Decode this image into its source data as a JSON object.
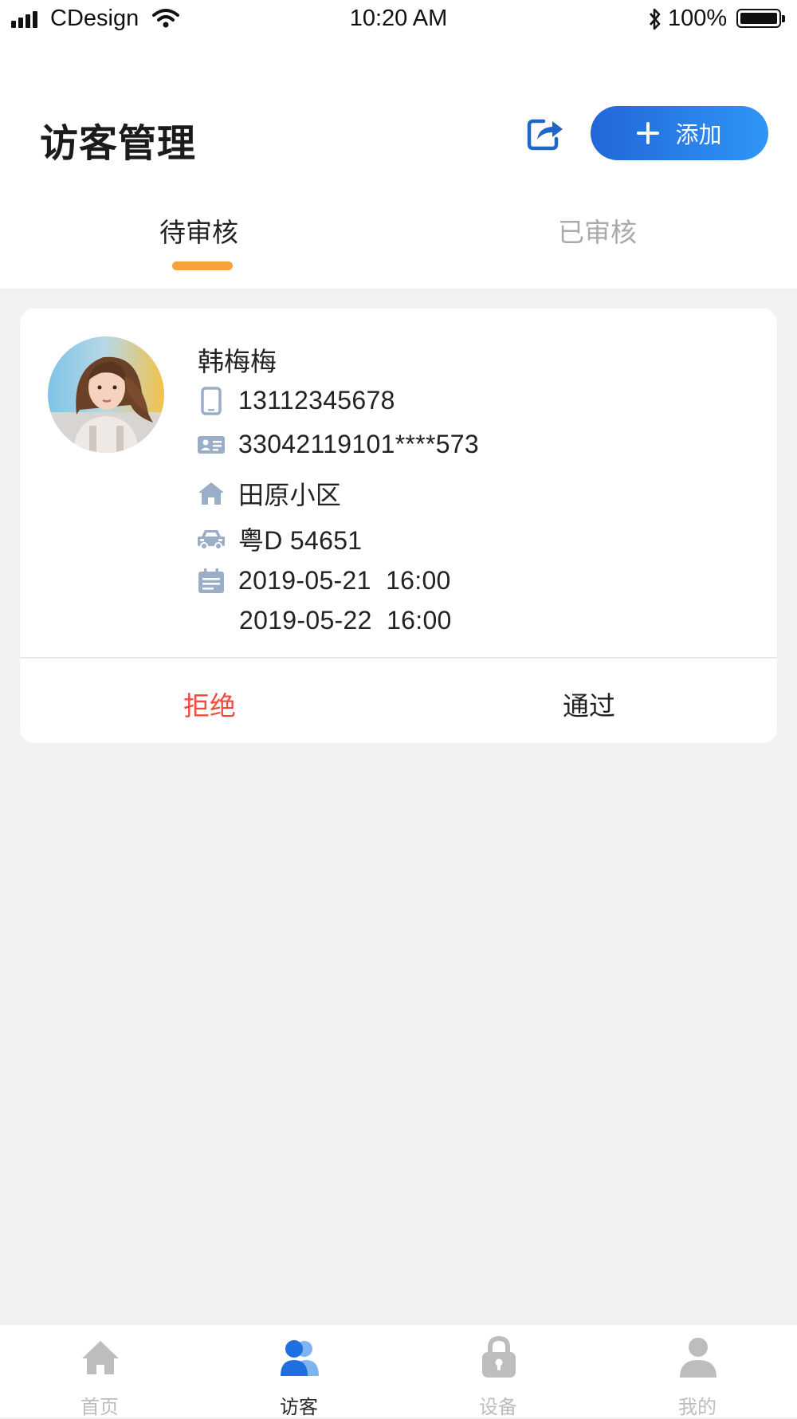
{
  "status_bar": {
    "carrier": "CDesign",
    "time": "10:20 AM",
    "battery": "100%"
  },
  "header": {
    "title": "访客管理",
    "add_label": "添加"
  },
  "tabs": [
    {
      "label": "待审核",
      "active": true
    },
    {
      "label": "已审核",
      "active": false
    }
  ],
  "visitor": {
    "name": "韩梅梅",
    "phone": "13112345678",
    "id_number": "33042119101****573",
    "community": "田原小区",
    "plate": "粤D 54651",
    "time_start": "2019-05-21  16:00",
    "time_end": "2019-05-22  16:00",
    "reject_label": "拒绝",
    "approve_label": "通过"
  },
  "icons": {
    "phone": "phone-icon",
    "id": "id-card-icon",
    "community": "home-icon",
    "plate": "car-icon",
    "time": "calendar-icon",
    "share": "share-icon"
  },
  "colors": {
    "accent": "#2a7ee8",
    "tab_indicator": "#f7a23a",
    "reject": "#f24a3d",
    "icon_gray": "#9aaec8"
  },
  "bottom_nav": [
    {
      "label": "首页",
      "icon": "home-icon",
      "active": false
    },
    {
      "label": "访客",
      "icon": "visitor-icon",
      "active": true
    },
    {
      "label": "设备",
      "icon": "lock-icon",
      "active": false
    },
    {
      "label": "我的",
      "icon": "person-icon",
      "active": false
    }
  ]
}
